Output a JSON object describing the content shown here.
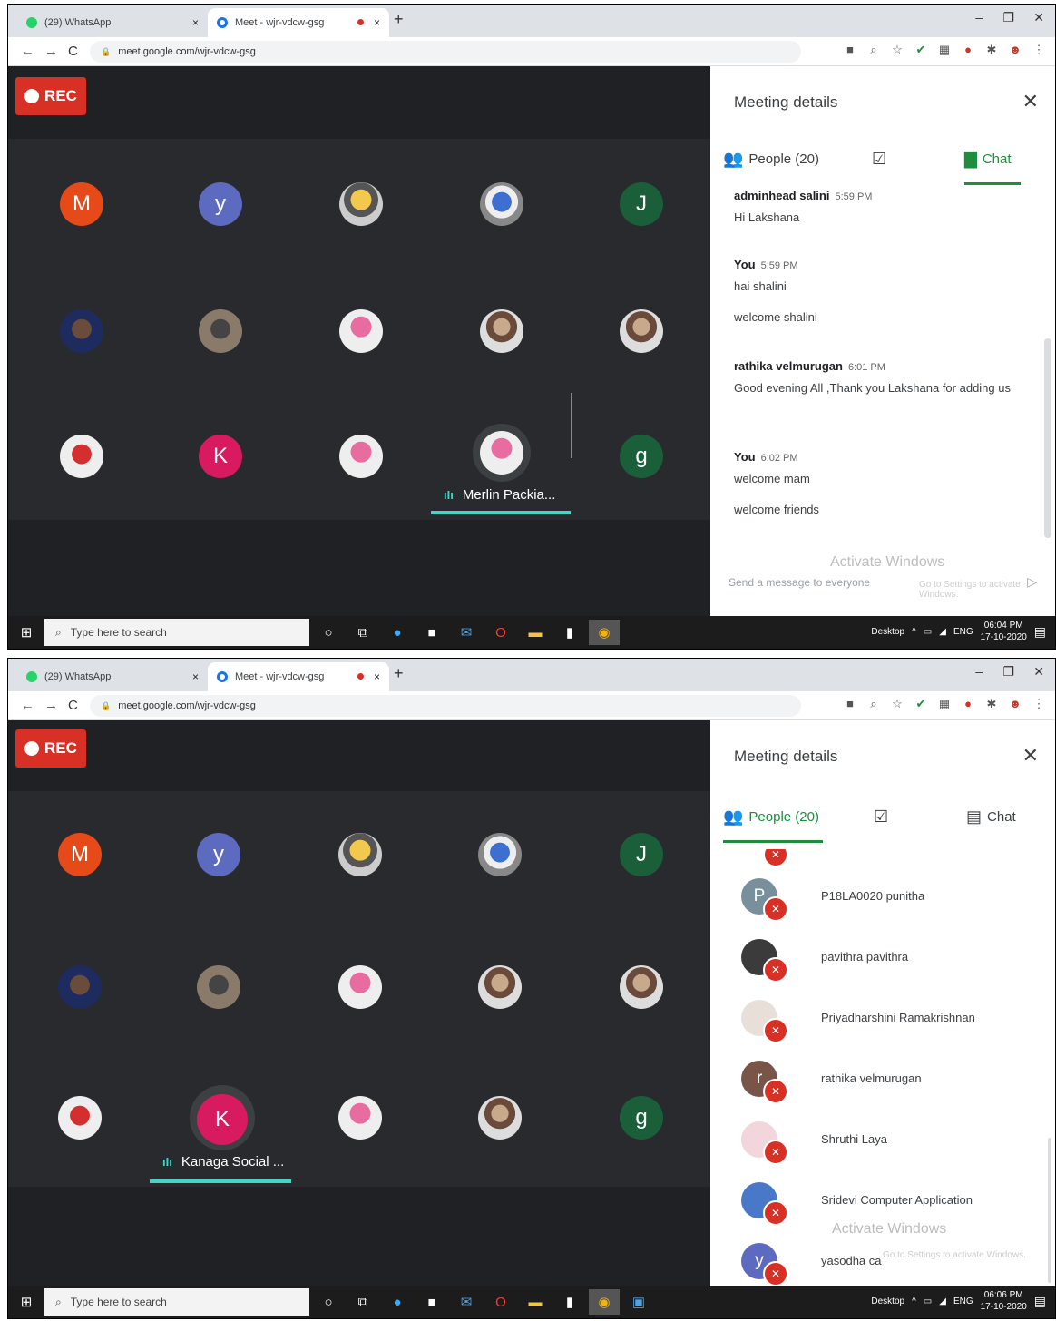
{
  "browser": {
    "tabs": [
      {
        "label": "(29) WhatsApp",
        "icon": "whatsapp-icon"
      },
      {
        "label": "Meet - wjr-vdcw-gsg",
        "icon": "meet-icon"
      }
    ],
    "close_glyph": "×",
    "new_tab_glyph": "+",
    "url": "meet.google.com/wjr-vdcw-gsg",
    "window_controls": [
      "–",
      "❐",
      "✕"
    ]
  },
  "meet": {
    "rec_label": "REC",
    "panel_title": "Meeting details",
    "people_tab_label": "People (20)",
    "chat_tab_label": "Chat",
    "grid_letters": {
      "m": "M",
      "y": "y",
      "j": "J",
      "k": "K",
      "g": "g"
    }
  },
  "screen1": {
    "speaker": "Merlin Packia...",
    "messages": [
      {
        "sender": "adminhead salini",
        "time": "5:59 PM",
        "lines": [
          "Hi Lakshana"
        ]
      },
      {
        "sender": "You",
        "time": "5:59 PM",
        "lines": [
          "hai shalini",
          "welcome shalini"
        ]
      },
      {
        "sender": "rathika velmurugan",
        "time": "6:01 PM",
        "lines": [
          "Good evening All ,Thank you Lakshana for adding us"
        ]
      },
      {
        "sender": "You",
        "time": "6:02 PM",
        "lines": [
          "welcome mam",
          "welcome friends"
        ]
      }
    ],
    "compose_placeholder": "Send a message to everyone",
    "watermark": "Activate Windows",
    "watermark_sub": "Go to Settings to activate Windows.",
    "clock_time": "06:04 PM",
    "clock_date": "17-10-2020"
  },
  "screen2": {
    "speaker": "Kanaga Social ...",
    "participants": [
      {
        "name": "P18LA0020 punitha",
        "initial": "P",
        "color": "#78909c"
      },
      {
        "name": "pavithra pavithra",
        "initial": "",
        "color": "#3b3b3b"
      },
      {
        "name": "Priyadharshini Ramakrishnan",
        "initial": "",
        "color": "#e8e0d8"
      },
      {
        "name": "rathika velmurugan",
        "initial": "r",
        "color": "#795548"
      },
      {
        "name": "Shruthi Laya",
        "initial": "",
        "color": "#f3d6dc"
      },
      {
        "name": "Sridevi Computer Application",
        "initial": "",
        "color": "#4a78c9"
      },
      {
        "name": "yasodha ca",
        "initial": "y",
        "color": "#5c6bc0"
      }
    ],
    "watermark": "Activate Windows",
    "watermark_sub": "Go to Settings to activate Windows.",
    "clock_time": "06:06 PM",
    "clock_date": "17-10-2020"
  },
  "taskbar": {
    "search_placeholder": "Type here to search",
    "desktop_label": "Desktop",
    "language": "ENG"
  },
  "colors": {
    "accent_green": "#1e8e3e",
    "rec_red": "#d93025",
    "meet_bg": "#202124",
    "speaking_teal": "#42d6c7"
  }
}
